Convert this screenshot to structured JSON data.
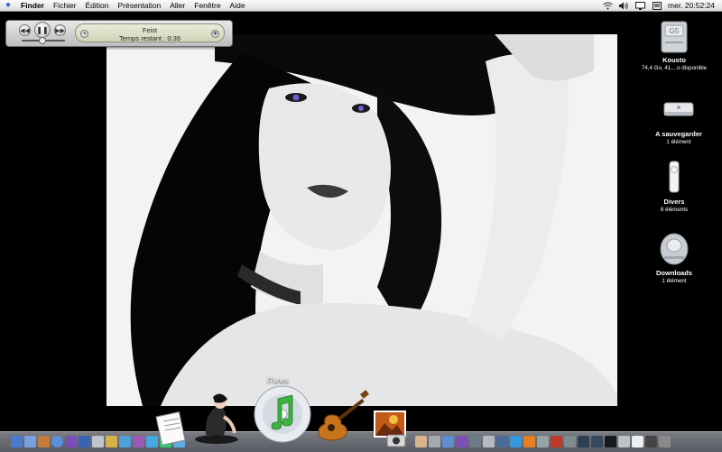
{
  "menubar": {
    "items": [
      "Finder",
      "Fichier",
      "Édition",
      "Présentation",
      "Aller",
      "Fenêtre",
      "Aide"
    ],
    "clock": "mer. 20:52:24",
    "tray_icons": [
      "wifi-icon",
      "volume-icon",
      "display-icon",
      "user-icon"
    ]
  },
  "itunes": {
    "artist": "Feist",
    "remaining": "Temps restant : 0:39",
    "volume": 0.45
  },
  "desktop_icons": [
    {
      "name": "Kousto",
      "sub": "74,4 Go, 41,...o disponible",
      "icon": "hard-drive-g5-icon"
    },
    {
      "name": "A sauvegarder",
      "sub": "1 élément",
      "icon": "mac-mini-icon"
    },
    {
      "name": "Divers",
      "sub": "8 éléments",
      "icon": "ipod-shuffle-icon"
    },
    {
      "name": "Downloads",
      "sub": "1 élément",
      "icon": "server-drive-icon"
    }
  ],
  "dock": {
    "hover_label": "iTunes",
    "big_apps": [
      "textedit-icon",
      "figure-art-icon",
      "itunes-icon",
      "garageband-icon",
      "photo-icon"
    ]
  },
  "colors": {
    "menubar": "#e8e8e8",
    "desktop": "#000000",
    "lcd": "#dde2c7",
    "itunes_green": "#3fb23f"
  }
}
